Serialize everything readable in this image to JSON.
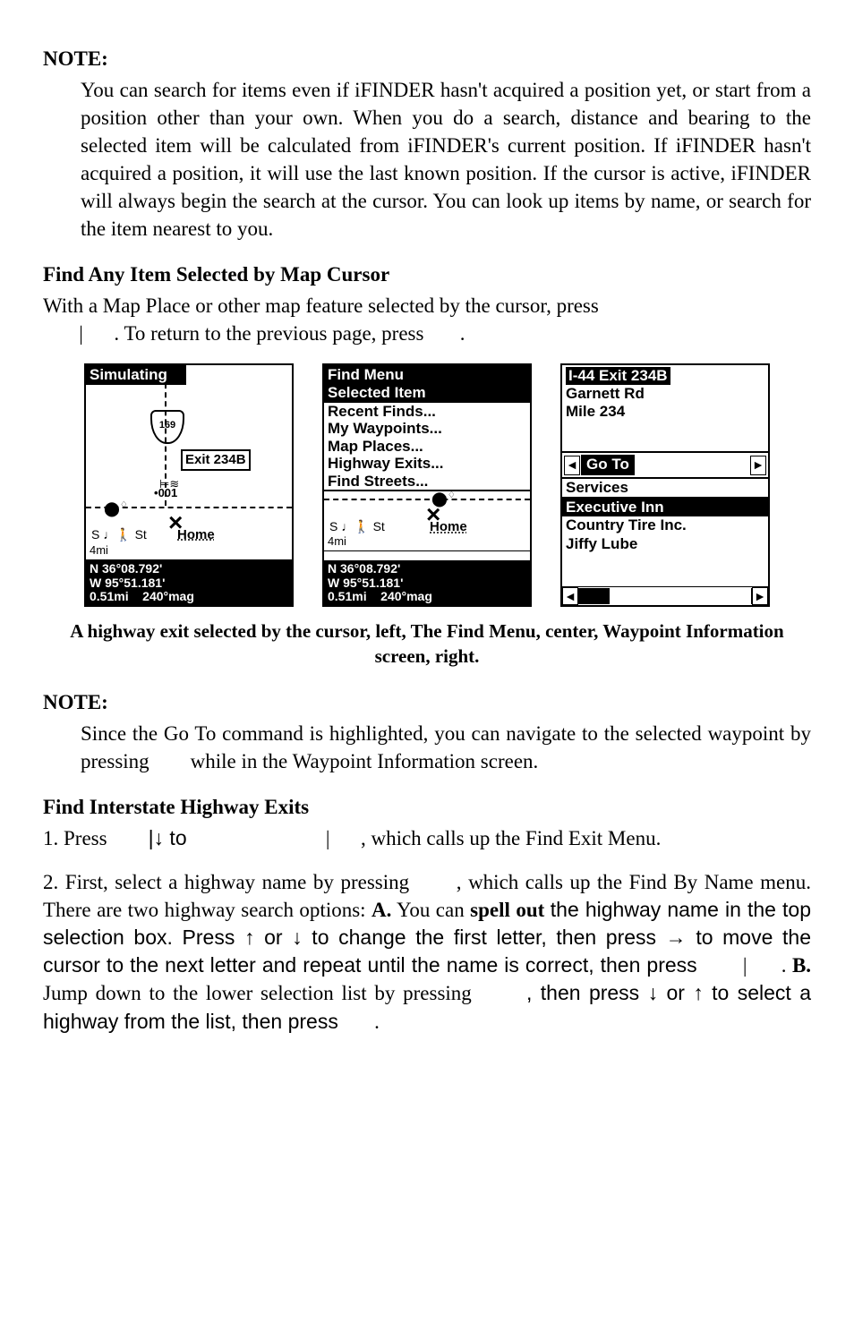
{
  "note1_heading": "NOTE:",
  "note1_body": "You can search for items even if iFINDER hasn't acquired a position yet, or start from a position other than your own. When you do a search, distance and bearing to the selected item will be calculated from iFINDER's current position. If iFINDER hasn't acquired a position, it will use the last known position. If the cursor is active, iFINDER will always begin the search at the cursor. You can look up items by name, or search for the item nearest to you.",
  "find_any_heading": "Find Any Item Selected by Map Cursor",
  "find_any_line1": "With a Map Place or other map feature selected by the cursor, press",
  "find_any_line2a": "|",
  "find_any_line2b": ". To return to the previous page, press",
  "find_any_line2c": ".",
  "screen1": {
    "title": "Simulating",
    "shield": "169",
    "exit": "Exit 234B",
    "zoom": "001",
    "home": "Home",
    "s": "S",
    "st": "St",
    "scale": "4mi",
    "status": {
      "lat": "N   36°08.792'",
      "lon": "W   95°51.181'",
      "dist": "0.51mi",
      "bear": "240°mag"
    }
  },
  "screen2": {
    "title1": "Find Menu",
    "title2": "Selected Item",
    "items": [
      "Recent Finds...",
      "My Waypoints...",
      "Map Places...",
      "Highway Exits...",
      "Find Streets..."
    ],
    "home": "Home",
    "s": "S",
    "st": "St",
    "scale": "4mi",
    "status": {
      "lat": "N   36°08.792'",
      "lon": "W   95°51.181'",
      "dist": "0.51mi",
      "bear": "240°mag"
    }
  },
  "screen3": {
    "title": "I-44 Exit 234B",
    "sub1": "Garnett Rd",
    "sub2": "Mile 234",
    "goto": "Go To",
    "services": "Services",
    "list": [
      "Executive Inn",
      "Country Tire Inc.",
      "Jiffy Lube"
    ]
  },
  "caption": "A highway exit selected by the cursor, left, The Find Menu, center, Waypoint Information screen, right.",
  "note2_heading": "NOTE:",
  "note2_body_a": "Since the Go To command is highlighted, you can navigate to the selected waypoint by pressing",
  "note2_body_b": "while in the Waypoint Information screen.",
  "find_hwy_heading": "Find Interstate Highway Exits",
  "step1_a": "1. Press",
  "step1_b": "|↓ to",
  "step1_c": "|",
  "step1_d": ", which calls up the Find Exit Menu.",
  "step2_a": "2. First, select a highway name by pressing",
  "step2_b": ", which calls up the Find By Name menu. There are two highway search options:",
  "step2_A": "A.",
  "step2_c": "You can",
  "step2_spell": "spell out",
  "step2_d": "the highway name in the top selection box. Press ↑ or ↓ to change the first letter, then press → to move the cursor to the next letter and repeat until the name is correct, then press",
  "step2_e": "|",
  "step2_f": ".",
  "step2_B": "B.",
  "step2_g": "Jump down to the lower selection list by pressing",
  "step2_h": ", then press ↓ or ↑ to select a highway from the list, then press",
  "step2_i": "."
}
